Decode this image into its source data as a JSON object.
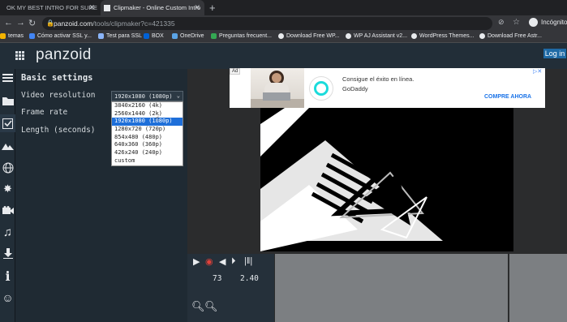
{
  "browser": {
    "tabs": [
      {
        "title": "OK MY BEST INTRO FOR SURE OK",
        "active": false
      },
      {
        "title": "Clipmaker - Online Custom Intro",
        "active": true
      }
    ],
    "url_host": "panzoid.com",
    "url_path": "/tools/clipmaker?c=421335",
    "profile": "Incógnito",
    "bookmarks": [
      {
        "label": "temas",
        "color": "#f4b400"
      },
      {
        "label": "Cómo activar SSL y...",
        "color": "#4285f4"
      },
      {
        "label": "Test para SSL",
        "color": "#8ab4f8"
      },
      {
        "label": "BOX",
        "color": "#0061d5"
      },
      {
        "label": "OneDrive",
        "color": "#5ba4e6"
      },
      {
        "label": "Preguntas frecuent...",
        "color": "#34a853"
      },
      {
        "label": "Download Free WP...",
        "color": "#e8eaed"
      },
      {
        "label": "WP AJ Assistant v2...",
        "color": "#e8eaed"
      },
      {
        "label": "WordPress Themes...",
        "color": "#e8eaed"
      },
      {
        "label": "Download Free Astr...",
        "color": "#e8eaed"
      }
    ]
  },
  "app": {
    "logo": "panzoid",
    "login": "Log in",
    "rail_icons": [
      "menu-icon",
      "folder-icon",
      "checkbox-icon",
      "landscape-icon",
      "globe-wireframe-icon",
      "burst-icon",
      "camera-icon",
      "music-icon",
      "download-icon",
      "info-icon",
      "smiley-icon"
    ]
  },
  "settings": {
    "title": "Basic settings",
    "video_resolution_label": "Video resolution",
    "frame_rate_label": "Frame rate",
    "length_label": "Length (seconds)",
    "selected_resolution": "1920x1080 (1080p)",
    "resolution_options": [
      "3840x2160 (4k)",
      "2560x1440 (2k)",
      "1920x1080 (1080p)",
      "1280x720 (720p)",
      "854x480 (480p)",
      "640x360 (360p)",
      "426x240 (240p)",
      "custom"
    ],
    "highlighted_option": 2
  },
  "ad": {
    "badge": "Ad",
    "headline": "Consigue el éxito en línea.",
    "brand": "GoDaddy",
    "cta": "COMPRE AHORA"
  },
  "player": {
    "frame": "73",
    "time": "2.40"
  },
  "colors": {
    "appbar": "#222e38",
    "panel": "#1f2a33",
    "accent": "#1f6aa5",
    "dropdown_highlight": "#1e6fd9"
  }
}
